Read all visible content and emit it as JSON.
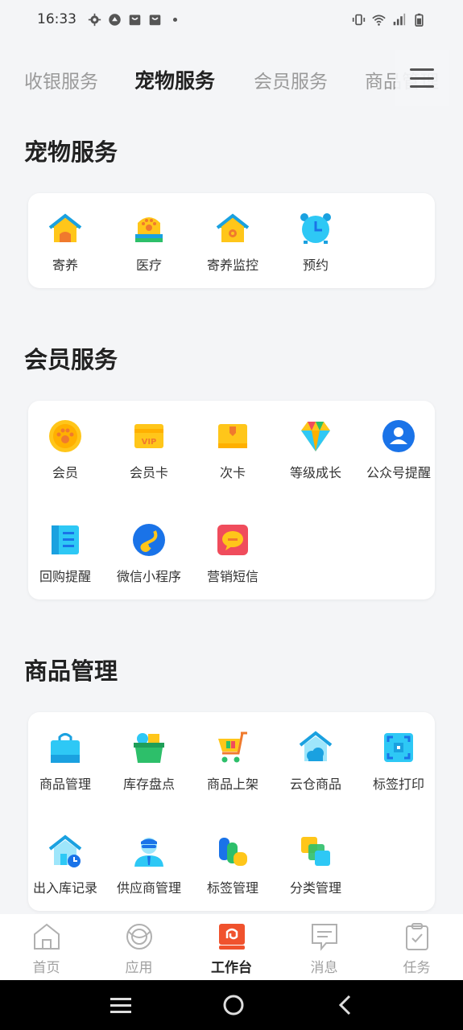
{
  "status": {
    "time": "16:33"
  },
  "tabs": [
    {
      "label": "收银服务"
    },
    {
      "label": "宠物服务"
    },
    {
      "label": "会员服务"
    },
    {
      "label": "商品管理"
    }
  ],
  "sections": {
    "pet": {
      "title": "宠物服务",
      "items": [
        {
          "label": "寄养",
          "icon": "boarding-house-icon"
        },
        {
          "label": "医疗",
          "icon": "medical-paw-icon"
        },
        {
          "label": "寄养监控",
          "icon": "boarding-monitor-icon"
        },
        {
          "label": "预约",
          "icon": "alarm-clock-icon"
        }
      ]
    },
    "member": {
      "title": "会员服务",
      "items": [
        {
          "label": "会员",
          "icon": "member-paw-icon"
        },
        {
          "label": "会员卡",
          "icon": "vip-card-icon"
        },
        {
          "label": "次卡",
          "icon": "punch-card-icon"
        },
        {
          "label": "等级成长",
          "icon": "diamond-icon"
        },
        {
          "label": "公众号提醒",
          "icon": "official-account-icon"
        },
        {
          "label": "回购提醒",
          "icon": "repurchase-book-icon"
        },
        {
          "label": "微信小程序",
          "icon": "mini-program-icon"
        },
        {
          "label": "营销短信",
          "icon": "sms-chat-icon"
        }
      ]
    },
    "goods": {
      "title": "商品管理",
      "items": [
        {
          "label": "商品管理",
          "icon": "shopping-bag-icon"
        },
        {
          "label": "库存盘点",
          "icon": "inventory-basket-icon"
        },
        {
          "label": "商品上架",
          "icon": "shopping-cart-icon"
        },
        {
          "label": "云仓商品",
          "icon": "cloud-warehouse-icon"
        },
        {
          "label": "标签打印",
          "icon": "scan-frame-icon"
        },
        {
          "label": "出入库记录",
          "icon": "stock-record-house-icon"
        },
        {
          "label": "供应商管理",
          "icon": "supplier-person-icon"
        },
        {
          "label": "标签管理",
          "icon": "tag-manage-icon"
        },
        {
          "label": "分类管理",
          "icon": "category-squares-icon"
        }
      ]
    }
  },
  "bottom_nav": [
    {
      "label": "首页",
      "icon": "home-icon"
    },
    {
      "label": "应用",
      "icon": "apps-icon"
    },
    {
      "label": "工作台",
      "icon": "workbench-icon"
    },
    {
      "label": "消息",
      "icon": "message-icon"
    },
    {
      "label": "任务",
      "icon": "task-clipboard-icon"
    }
  ],
  "colors": {
    "accent_orange": "#f0522d",
    "icon_yellow": "#ffc61a",
    "icon_cyan": "#2ec8f5",
    "icon_blue": "#1a73e8",
    "icon_red": "#f04c5c",
    "icon_green": "#2dbf6a"
  }
}
